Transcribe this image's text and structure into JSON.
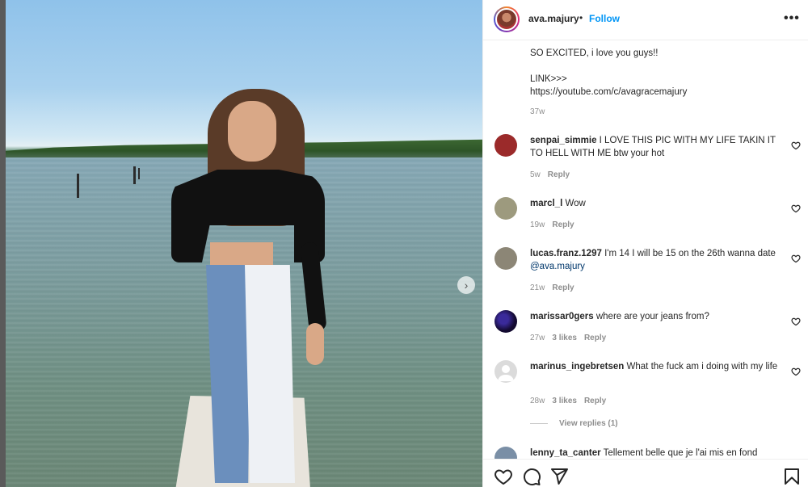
{
  "post": {
    "username": "ava.majury",
    "separator": "•",
    "follow_label": "Follow",
    "more_label": "•••",
    "caption_lines": [
      "SO EXCITED, i love you guys!!",
      "",
      "LINK>>>",
      "https://youtube.com/c/avagracemajury"
    ],
    "caption_time": "37w"
  },
  "photo": {
    "next_label": "›"
  },
  "comments": [
    {
      "username": "senpai_simmie",
      "text": "I LOVE THIS PIC WITH MY LIFE TAKIN IT TO HELL WITH ME btw your hot",
      "time": "5w",
      "likes": "",
      "reply": "Reply",
      "avatar_color": "#9b2a2a"
    },
    {
      "username": "marcl_l",
      "text": "Wow",
      "time": "19w",
      "likes": "",
      "reply": "Reply",
      "avatar_color": "#9d9a7e"
    },
    {
      "username": "lucas.franz.1297",
      "text": "I'm 14 I will be 15 on the 26th wanna date ",
      "mention": "@ava.majury",
      "time": "21w",
      "likes": "",
      "reply": "Reply",
      "avatar_color": "#8c8676"
    },
    {
      "username": "marissar0gers",
      "text": "where are your jeans from?",
      "time": "27w",
      "likes": "3 likes",
      "reply": "Reply",
      "avatar_color": "#1d1140"
    },
    {
      "username": "marinus_ingebretsen",
      "text": "What the fuck am i doing with my life",
      "time": "28w",
      "likes": "3 likes",
      "reply": "Reply",
      "avatar_color": "#dbdbdb"
    },
    {
      "username": "lenny_ta_canter",
      "text": "Tellement belle que je l'ai mis en fond",
      "time": "",
      "likes": "",
      "reply": "",
      "avatar_color": "#7a8fa6"
    }
  ],
  "view_replies": "View replies (1)",
  "actions": {
    "like": "heart-icon",
    "comment": "comment-icon",
    "share": "share-icon",
    "save": "bookmark-icon"
  },
  "colors": {
    "accent": "#0095f6",
    "text": "#262626",
    "muted": "#8e8e8e",
    "mention": "#00376b"
  }
}
